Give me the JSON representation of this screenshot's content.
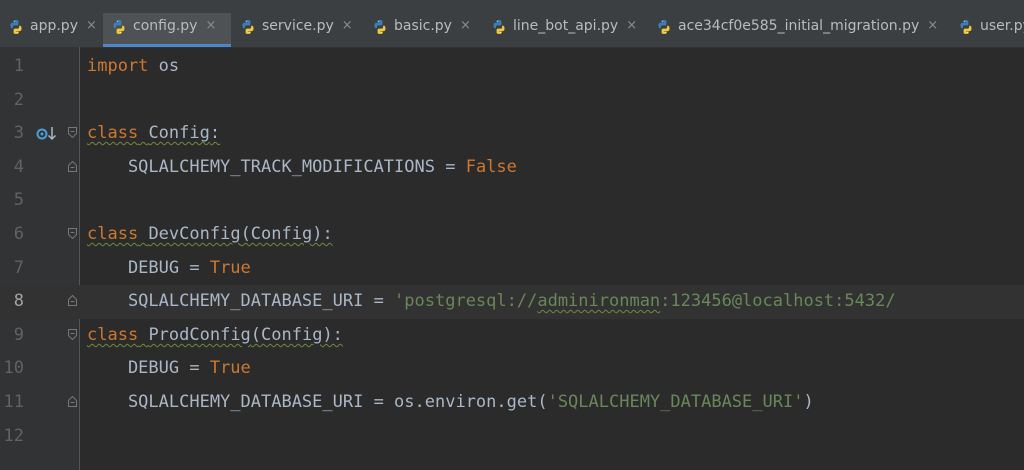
{
  "tabs": [
    {
      "label": "app.py"
    },
    {
      "label": "config.py"
    },
    {
      "label": "service.py"
    },
    {
      "label": "basic.py"
    },
    {
      "label": "line_bot_api.py"
    },
    {
      "label": "ace34cf0e585_initial_migration.py"
    },
    {
      "label": "user.py"
    }
  ],
  "tab_close_glyph": "×",
  "active_tab": "config.py",
  "colors": {
    "background": "#2b2b2b",
    "keyword": "#cc7832",
    "identifier": "#a9b7c6",
    "string": "#6a8759",
    "line_number": "#606366",
    "tab_underline": "#4a88c7"
  },
  "editor": {
    "current_line": 8,
    "lines": [
      {
        "num": "1",
        "parts": {
          "p0": "import",
          "p1": " os"
        }
      },
      {
        "num": "2"
      },
      {
        "num": "3",
        "parts": {
          "p0": "class",
          "p1": " ",
          "p2": "Config",
          "p3": ":"
        }
      },
      {
        "num": "4",
        "parts": {
          "p0": "    SQLALCHEMY_TRACK_MODIFICATIONS = ",
          "p1": "False"
        }
      },
      {
        "num": "5"
      },
      {
        "num": "6",
        "parts": {
          "p0": "class",
          "p1": " ",
          "p2": "DevConfig",
          "p3": "(Config):"
        }
      },
      {
        "num": "7",
        "parts": {
          "p0": "    DEBUG = ",
          "p1": "True"
        }
      },
      {
        "num": "8",
        "parts": {
          "p0": "    SQLALCHEMY_DATABASE_URI = ",
          "p1": "'postgresql://",
          "p2": "adminironman",
          "p3": ":123456@localhost:5432/"
        }
      },
      {
        "num": "9",
        "parts": {
          "p0": "class",
          "p1": " ",
          "p2": "ProdConfig",
          "p3": "(Config):"
        }
      },
      {
        "num": "10",
        "parts": {
          "p0": "    DEBUG = ",
          "p1": "True"
        }
      },
      {
        "num": "11",
        "parts": {
          "p0": "    SQLALCHEMY_DATABASE_URI = os.environ.get(",
          "p1": "'SQLALCHEMY_DATABASE_URI'",
          "p2": ")"
        }
      },
      {
        "num": "12"
      }
    ]
  }
}
